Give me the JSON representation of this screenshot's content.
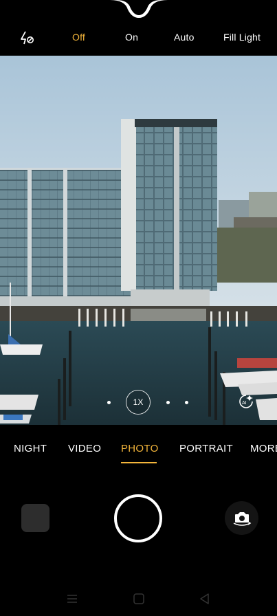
{
  "flash": {
    "icon": "flash-off-icon",
    "options": [
      {
        "label": "Off",
        "active": true
      },
      {
        "label": "On",
        "active": false
      },
      {
        "label": "Auto",
        "active": false
      },
      {
        "label": "Fill Light",
        "active": false
      }
    ]
  },
  "viewfinder": {
    "zoom_label": "1X",
    "ai_icon": "ai-scene-icon"
  },
  "modes": {
    "items": [
      "NIGHT",
      "VIDEO",
      "PHOTO",
      "PORTRAIT",
      "MORE"
    ],
    "active": "PHOTO"
  },
  "controls": {
    "gallery_icon": "gallery-thumbnail",
    "shutter_icon": "shutter-button",
    "switch_icon": "camera-switch-icon"
  },
  "navbar": {
    "icons": [
      "menu-icon",
      "home-icon",
      "back-icon"
    ]
  },
  "colors": {
    "accent": "#f4b63b",
    "background": "#000000"
  }
}
